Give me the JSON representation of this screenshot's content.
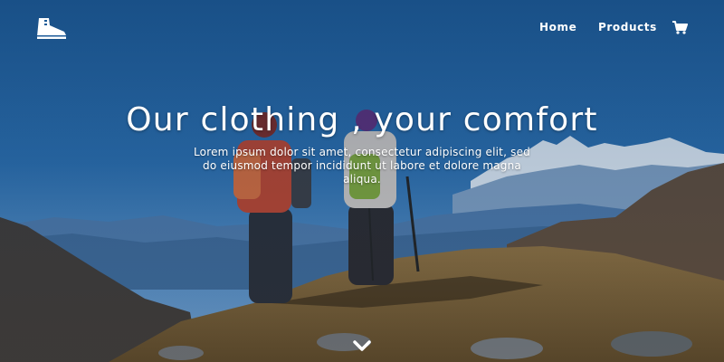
{
  "nav": {
    "logo_icon": "boot-icon",
    "home_label": "Home",
    "products_label": "Products",
    "cart_icon": "cart-icon"
  },
  "hero": {
    "headline": "Our clothing , your comfort",
    "lede": "Lorem ipsum dolor sit amet, consectetur adipiscing elit, sed do eiusmod tempor incididunt ut labore et dolore magna aliqua.",
    "scroll_icon": "chevron-down-icon"
  },
  "colors": {
    "sky": "#1d5b98",
    "text": "#ffffff",
    "overlay": "#0d2f55"
  }
}
